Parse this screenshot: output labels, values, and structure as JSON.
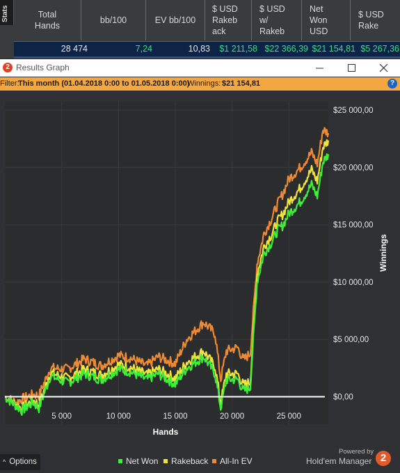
{
  "stats_panel": {
    "tab_label": "Stats",
    "columns": [
      "Total\nHands",
      "bb/100",
      "EV bb/100",
      "$ USD\nRakeb\nack",
      "$ USD\nw/\nRakeb",
      "Net\nWon\nUSD",
      "$ USD\nRake"
    ],
    "values": [
      "28 474",
      "7,24",
      "10,83",
      "$1 211,58",
      "$22 366,39",
      "$21 154,81",
      "$5 267,36"
    ]
  },
  "window": {
    "title": "Results Graph",
    "app_icon": "2",
    "controls": [
      "minimize-icon",
      "maximize-icon",
      "close-icon"
    ]
  },
  "filter": {
    "label": "Filter:",
    "value": "This month (01.04.2018 0:00 to 01.05.2018 0:00)",
    "winnings_label": "Winnings:",
    "winnings_value": "$21 154,81",
    "help_icon": "?"
  },
  "chart_data": {
    "type": "line",
    "xlabel": "Hands",
    "ylabel": "Winnings",
    "xlim": [
      0,
      28474
    ],
    "ylim": [
      -2400,
      25800
    ],
    "x_ticks": [
      5000,
      10000,
      15000,
      20000,
      25000
    ],
    "x_tick_labels": [
      "5 000",
      "10 000",
      "15 000",
      "20 000",
      "25 000"
    ],
    "y_ticks": [
      0,
      5000,
      10000,
      15000,
      20000,
      25000
    ],
    "y_tick_labels": [
      "$0,00",
      "$5 000,00",
      "$10 000,00",
      "$15 000,00",
      "$20 000,00",
      "$25 000,00"
    ],
    "grid": true,
    "legend_position": "bottom",
    "x": [
      0,
      1000,
      1500,
      2500,
      3000,
      4000,
      5500,
      7000,
      8500,
      10000,
      11000,
      12500,
      13500,
      15000,
      16000,
      17500,
      18500,
      19000,
      19500,
      20500,
      21000,
      21600,
      22200,
      22800,
      23500,
      24000,
      24500,
      25000,
      26000,
      27000,
      27500,
      28000,
      28474
    ],
    "series": [
      {
        "name": "Net Won",
        "color": "#3cf037",
        "values": [
          0,
          -800,
          -1200,
          -500,
          -1000,
          1800,
          1200,
          2000,
          1500,
          2400,
          2200,
          1500,
          2000,
          1100,
          2500,
          3500,
          2000,
          -1000,
          1500,
          1500,
          500,
          800,
          10000,
          12500,
          13500,
          14500,
          15000,
          16000,
          17000,
          18500,
          17500,
          20500,
          21155
        ]
      },
      {
        "name": "Rakeback",
        "color": "#f0e43a",
        "values": [
          0,
          -700,
          -1000,
          -300,
          -700,
          2100,
          1600,
          2400,
          1900,
          2800,
          2600,
          1900,
          2400,
          1600,
          3000,
          4000,
          2600,
          -500,
          2000,
          2000,
          1000,
          1300,
          10700,
          13100,
          14200,
          15300,
          16000,
          17000,
          18200,
          19800,
          18800,
          21800,
          22366
        ]
      },
      {
        "name": "All-In EV",
        "color": "#ef8a34",
        "values": [
          0,
          -500,
          -200,
          200,
          100,
          2500,
          2400,
          3300,
          2700,
          3600,
          3400,
          2700,
          3500,
          2900,
          5000,
          6500,
          5500,
          1500,
          4000,
          4300,
          3200,
          3800,
          11600,
          14200,
          15600,
          16800,
          17800,
          19000,
          20000,
          21300,
          20300,
          23300,
          23000
        ]
      }
    ]
  },
  "legend": [
    {
      "label": "Net Won",
      "color": "#3cf037"
    },
    {
      "label": "Rakeback",
      "color": "#f0e43a"
    },
    {
      "label": "All-In EV",
      "color": "#ef8a34"
    }
  ],
  "footer": {
    "options_label": "Options",
    "powered_by": "Powered by",
    "brand": "Hold'em Manager",
    "brand_logo": "2"
  }
}
